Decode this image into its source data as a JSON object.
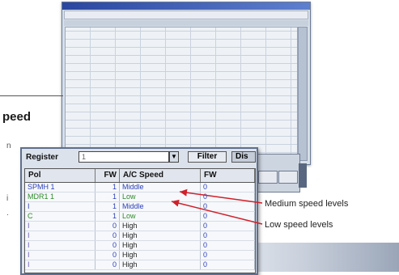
{
  "left_heading": "peed",
  "left_crop_chars": [
    "n",
    "i",
    "."
  ],
  "register_label": "Register",
  "register_value": "1",
  "filter_button": "Filter",
  "display_button": "Dis",
  "table": {
    "headers": [
      "Pol",
      "FW",
      "A/C Speed",
      "FW"
    ],
    "rows": [
      {
        "pol": "SPMH 1",
        "fw": "1",
        "speed": "Middle",
        "fw2": "0",
        "pol_color": "#2b3fb8",
        "speed_color": "#2b3fb8"
      },
      {
        "pol": "MDR1 1",
        "fw": "1",
        "speed": "Low",
        "fw2": "0",
        "pol_color": "#2f8a2a",
        "speed_color": "#2f8a2a"
      },
      {
        "pol": "I",
        "fw": "1",
        "speed": "Middle",
        "fw2": "0",
        "pol_color": "#2b3fb8",
        "speed_color": "#2b3fb8"
      },
      {
        "pol": "C",
        "fw": "1",
        "speed": "Low",
        "fw2": "0",
        "pol_color": "#2f8a2a",
        "speed_color": "#2f8a2a"
      },
      {
        "pol": "I",
        "fw": "0",
        "speed": "High",
        "fw2": "0",
        "pol_color": "#6a5cc4",
        "speed_color": "#222222"
      },
      {
        "pol": "I",
        "fw": "0",
        "speed": "High",
        "fw2": "0",
        "pol_color": "#6a5cc4",
        "speed_color": "#222222"
      },
      {
        "pol": "I",
        "fw": "0",
        "speed": "High",
        "fw2": "0",
        "pol_color": "#6a5cc4",
        "speed_color": "#222222"
      },
      {
        "pol": "I",
        "fw": "0",
        "speed": "High",
        "fw2": "0",
        "pol_color": "#6a5cc4",
        "speed_color": "#222222"
      },
      {
        "pol": "I",
        "fw": "0",
        "speed": "High",
        "fw2": "0",
        "pol_color": "#6a5cc4",
        "speed_color": "#222222"
      }
    ]
  },
  "callouts": {
    "medium": "Medium speed levels",
    "low": "Low speed levels"
  },
  "colors": {
    "arrow": "#d0202a",
    "accent_blue": "#2b3fb8",
    "accent_green": "#2f8a2a"
  }
}
